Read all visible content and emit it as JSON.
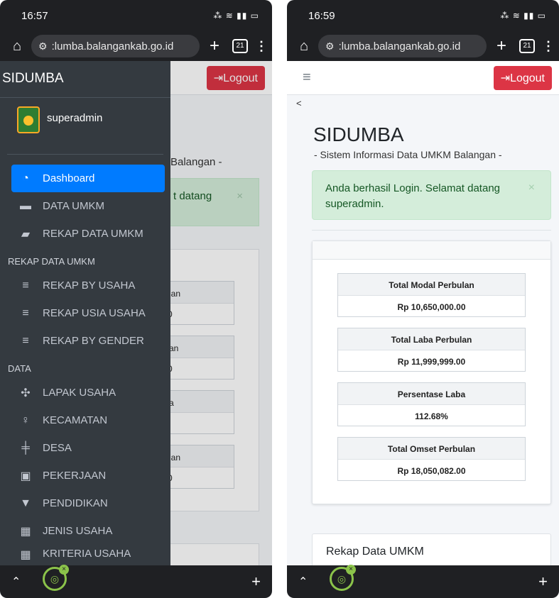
{
  "left": {
    "status": {
      "time": "16:57",
      "icons": "⁂ ≋ ▮▮ ▭"
    },
    "browser": {
      "url": ":lumba.balangankab.go.id",
      "tab_count": "21"
    },
    "navbar": {
      "logout": "Logout"
    },
    "background_fragments": {
      "subtitle_tail": "Balangan -",
      "alert_tail": "t datang",
      "mini": [
        {
          "label": "lan",
          "value": "0"
        },
        {
          "label": "an",
          "value": "0"
        },
        {
          "label": "a",
          "value": ""
        },
        {
          "label": "lan",
          "value": "0"
        }
      ]
    },
    "sidebar": {
      "brand": "SIDUMBA",
      "user": "superadmin",
      "items_top": [
        {
          "label": "Dashboard",
          "icon": "gauge-icon",
          "active": true
        },
        {
          "label": "DATA UMKM",
          "icon": "archive-icon"
        },
        {
          "label": "REKAP DATA UMKM",
          "icon": "folder-open-icon"
        }
      ],
      "header_rekap": "REKAP DATA UMKM",
      "items_rekap": [
        {
          "label": "REKAP BY USAHA",
          "icon": "bars-icon"
        },
        {
          "label": "REKAP USIA USAHA",
          "icon": "bars-icon"
        },
        {
          "label": "REKAP BY GENDER",
          "icon": "bars-icon"
        }
      ],
      "header_data": "DATA",
      "items_data": [
        {
          "label": "LAPAK USAHA",
          "icon": "cubes-icon"
        },
        {
          "label": "KECAMATAN",
          "icon": "map-pin-icon"
        },
        {
          "label": "DESA",
          "icon": "signs-icon"
        },
        {
          "label": "PEKERJAAN",
          "icon": "briefcase-icon"
        },
        {
          "label": "PENDIDIKAN",
          "icon": "graduation-cap-icon"
        },
        {
          "label": "JENIS USAHA",
          "icon": "grid-icon"
        },
        {
          "label": "KRITERIA USAHA",
          "icon": "grid-icon"
        }
      ]
    }
  },
  "right": {
    "status": {
      "time": "16:59",
      "icons": "⁂ ≋ ▮▮ ▭"
    },
    "browser": {
      "url": ":lumba.balangankab.go.id",
      "tab_count": "21"
    },
    "navbar": {
      "logout": "Logout"
    },
    "back": "<",
    "title": "SIDUMBA",
    "subtitle": "- Sistem Informasi Data UMKM Balangan -",
    "alert": "Anda berhasil Login. Selamat datang superadmin.",
    "stats": [
      {
        "label": "Total Modal Perbulan",
        "value": "Rp 10,650,000.00"
      },
      {
        "label": "Total Laba Perbulan",
        "value": "Rp 11,999,999.00"
      },
      {
        "label": "Persentase Laba",
        "value": "112.68%"
      },
      {
        "label": "Total Omset Perbulan",
        "value": "Rp 18,050,082.00"
      }
    ],
    "rekap_title": "Rekap Data UMKM"
  },
  "colors": {
    "sidebar": "#343a40",
    "active": "#007bff",
    "logout": "#dc3545",
    "alert_bg": "#d4edda"
  }
}
